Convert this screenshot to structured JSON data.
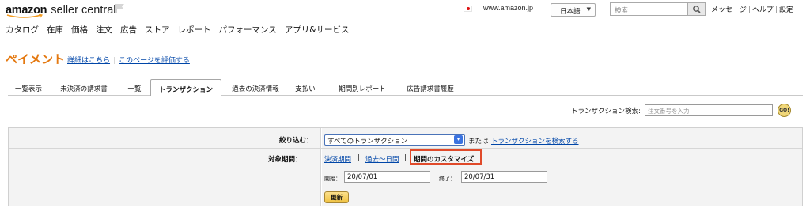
{
  "header": {
    "logo_brand": "amazon",
    "logo_product": "seller central",
    "marketplace": "www.amazon.jp",
    "language": "日本語",
    "search_placeholder": "検索",
    "links": [
      "メッセージ",
      "ヘルプ",
      "設定"
    ]
  },
  "nav": [
    "カタログ",
    "在庫",
    "価格",
    "注文",
    "広告",
    "ストア",
    "レポート",
    "パフォーマンス",
    "アプリ&サービス"
  ],
  "page": {
    "title": "ペイメント",
    "detail_link": "詳細はこちら",
    "rate_link": "このページを評価する"
  },
  "tabs": [
    {
      "label": "一覧表示",
      "active": false
    },
    {
      "label": "未決済の請求書",
      "active": false
    },
    {
      "label": "一覧",
      "active": false
    },
    {
      "label": "トランザクション",
      "active": true
    },
    {
      "label": "過去の決済情報",
      "active": false
    },
    {
      "label": "支払い",
      "active": false
    },
    {
      "label": "期間別レポート",
      "active": false
    },
    {
      "label": "広告請求書履歴",
      "active": false
    }
  ],
  "transaction_search": {
    "label": "トランザクション検索:",
    "placeholder": "注文番号を入力",
    "go_label": "GO!"
  },
  "filter": {
    "filter_label": "絞り込む：",
    "selected": "すべてのトランザクション",
    "or_text": "または",
    "search_link": "トランザクションを検索する",
    "period_label": "対象期間：",
    "period_options": [
      "決済期間",
      "過去〜日間",
      "期間のカスタマイズ"
    ],
    "start_label": "開始：",
    "start_value": "20/07/01",
    "end_label": "終了：",
    "end_value": "20/07/31",
    "update_label": "更新"
  },
  "colors": {
    "title_orange": "#e47911",
    "link_blue": "#0046a8",
    "highlight_red": "#e04a2a",
    "button_gold": "#f0c242"
  }
}
